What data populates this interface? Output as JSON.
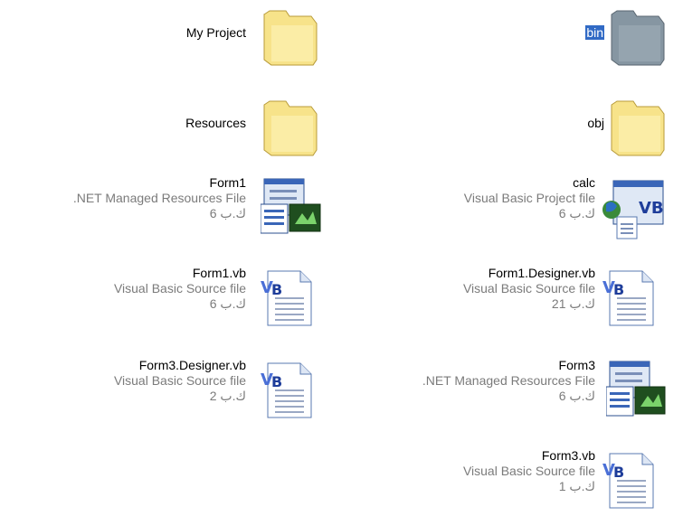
{
  "colors": {
    "background": "#ffffff",
    "selection": "#316ac5",
    "secondary_text": "#7b7b7b",
    "folder": "#f7e27b",
    "selected_folder": "#8a9aa6"
  },
  "items": [
    {
      "name": "My Project",
      "icon": "folder-icon"
    },
    {
      "name": "bin",
      "icon": "folder-icon",
      "selected": true
    },
    {
      "name": "Resources",
      "icon": "folder-icon"
    },
    {
      "name": "obj",
      "icon": "folder-icon"
    },
    {
      "name": "Form1",
      "type": ".NET Managed Resources File",
      "size": "6 ك.ب",
      "icon": "resx-file-icon"
    },
    {
      "name": "calc",
      "type": "Visual Basic Project file",
      "size": "6 ك.ب",
      "icon": "vbproj-file-icon"
    },
    {
      "name": "Form1.vb",
      "type": "Visual Basic Source file",
      "size": "6 ك.ب",
      "icon": "vb-source-file-icon"
    },
    {
      "name": "Form1.Designer.vb",
      "type": "Visual Basic Source file",
      "size": "21 ك.ب",
      "icon": "vb-source-file-icon"
    },
    {
      "name": "Form3.Designer.vb",
      "type": "Visual Basic Source file",
      "size": "2 ك.ب",
      "icon": "vb-source-file-icon"
    },
    {
      "name": "Form3",
      "type": ".NET Managed Resources File",
      "size": "6 ك.ب",
      "icon": "resx-file-icon"
    },
    {
      "name": "Form3.vb",
      "type": "Visual Basic Source file",
      "size": "1 ك.ب",
      "icon": "vb-source-file-icon"
    }
  ]
}
